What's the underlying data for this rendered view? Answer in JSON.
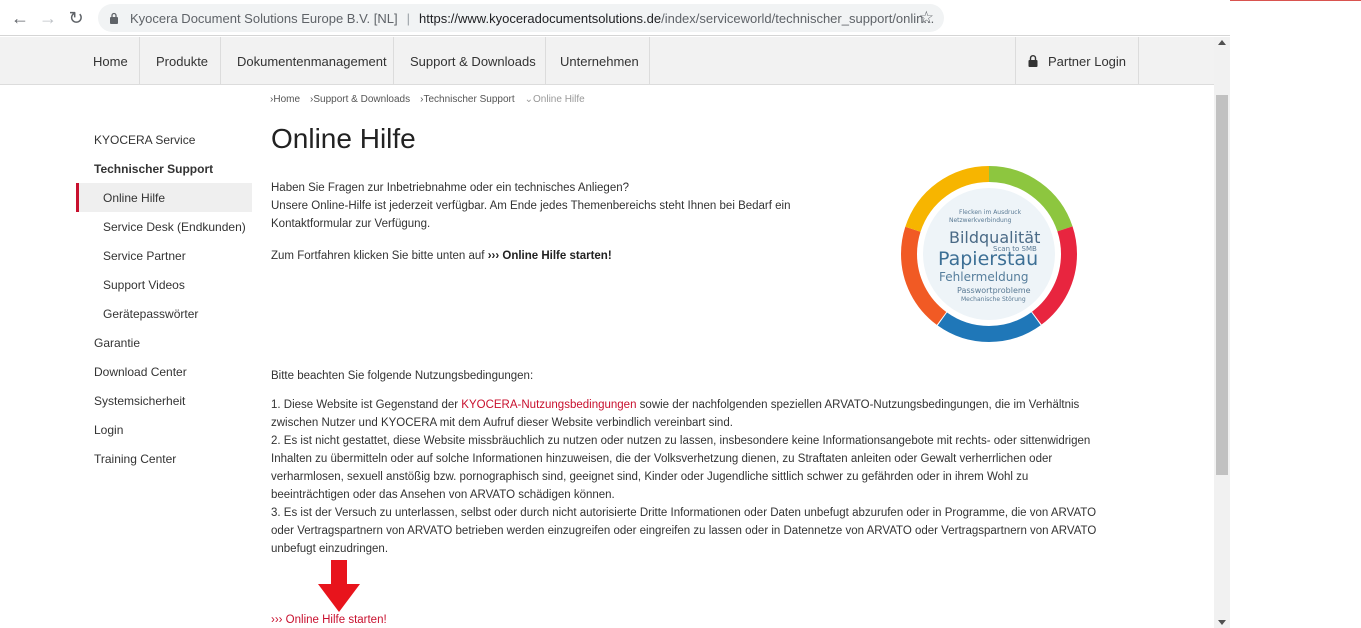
{
  "browser": {
    "site_name": "Kyocera Document Solutions Europe B.V. [NL]",
    "url_host": "https://www.kyoceradocumentsolutions.de",
    "url_path": "/index/serviceworld/technischer_support/onlin..."
  },
  "mainnav": {
    "items": [
      "Home",
      "Produkte",
      "Dokumentenmanagement",
      "Support & Downloads",
      "Unternehmen"
    ],
    "partner_login": "Partner Login"
  },
  "breadcrumb": [
    "Home",
    "Support & Downloads",
    "Technischer Support",
    "Online Hilfe"
  ],
  "sidebar": {
    "items": [
      {
        "label": "KYOCERA Service"
      },
      {
        "label": "Technischer Support"
      },
      {
        "label": "Online Hilfe"
      },
      {
        "label": "Service Desk (Endkunden)"
      },
      {
        "label": "Service Partner"
      },
      {
        "label": "Support Videos"
      },
      {
        "label": "Gerätepasswörter"
      },
      {
        "label": "Garantie"
      },
      {
        "label": "Download Center"
      },
      {
        "label": "Systemsicherheit"
      },
      {
        "label": "Login"
      },
      {
        "label": "Training Center"
      }
    ]
  },
  "content": {
    "title": "Online Hilfe",
    "intro_line1": "Haben Sie Fragen zur Inbetriebnahme oder ein technisches Anliegen?",
    "intro_line2": "Unsere Online-Hilfe ist jederzeit verfügbar. Am Ende jedes Themenbereichs steht Ihnen bei Bedarf ein Kontaktformular zur Verfügung.",
    "cta_prefix": "Zum Fortfahren klicken Sie bitte unten auf",
    "cta_link": "››› Online Hilfe starten!",
    "terms_title": "Bitte beachten Sie folgende Nutzungsbedingungen:",
    "terms_1a": "1. Diese Website ist Gegenstand der",
    "terms_1_link": "KYOCERA-Nutzungsbedingungen",
    "terms_1b": "sowie der nachfolgenden speziellen ARVATO-Nutzungsbedingungen, die im Verhältnis zwischen Nutzer und KYOCERA mit dem Aufruf dieser Website verbindlich vereinbart sind.",
    "terms_2": "2. Es ist nicht gestattet, diese Website missbräuchlich zu nutzen oder nutzen zu lassen, insbesondere keine Informationsangebote mit rechts- oder sittenwidrigen Inhalten zu übermitteln oder auf solche Informationen hinzuweisen, die der Volksverhetzung dienen, zu Straftaten anleiten oder Gewalt verherrlichen oder verharmlosen, sexuell anstößig bzw. pornographisch sind, geeignet sind, Kinder oder Jugendliche sittlich schwer zu gefährden oder in ihrem Wohl zu beeinträchtigen oder das Ansehen von ARVATO schädigen können.",
    "terms_3": "3. Es ist der Versuch zu unterlassen, selbst oder durch nicht autorisierte Dritte Informationen oder Daten unbefugt abzurufen oder in Programme, die von ARVATO oder Vertragspartnern von ARVATO betrieben werden einzugreifen oder eingreifen zu lassen oder in Datennetze von ARVATO oder Vertragspartnern von ARVATO unbefugt einzudringen.",
    "bottom_link": "››› Online Hilfe starten!"
  },
  "wordcloud": {
    "words": [
      "Bildqualität",
      "Papierstau",
      "Fehlermeldung",
      "Passwortprobleme",
      "Scan to SMB",
      "Netzwerkverbindung",
      "Flecken im Ausdruck",
      "Mechanische Störung"
    ],
    "ring_colors": [
      "#8dc63f",
      "#e8253f",
      "#1f77b8",
      "#f15a24",
      "#f7b500"
    ]
  },
  "colors": {
    "accent": "#c8102e"
  }
}
